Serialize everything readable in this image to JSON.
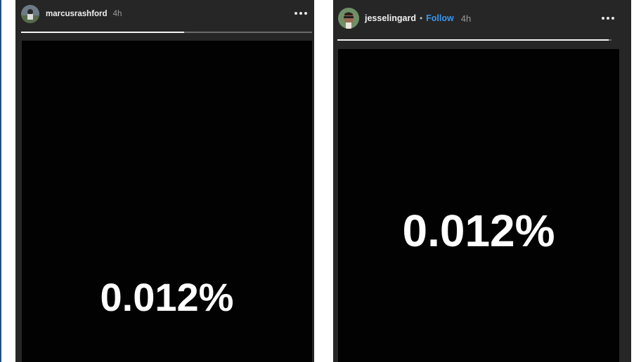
{
  "left_story": {
    "username": "marcusrashford",
    "time": "4h",
    "progress": 0.56,
    "text": "0.012%"
  },
  "right_story": {
    "username": "jesselingard",
    "separator": "•",
    "follow_label": "Follow",
    "time": "4h",
    "progress": 0.99,
    "text": "0.012%"
  },
  "colors": {
    "story_background": "#262626",
    "frame_background": "#020202",
    "follow_blue": "#3897f0",
    "text_white": "#ffffff"
  },
  "icons": {
    "more": "more-options-icon"
  }
}
